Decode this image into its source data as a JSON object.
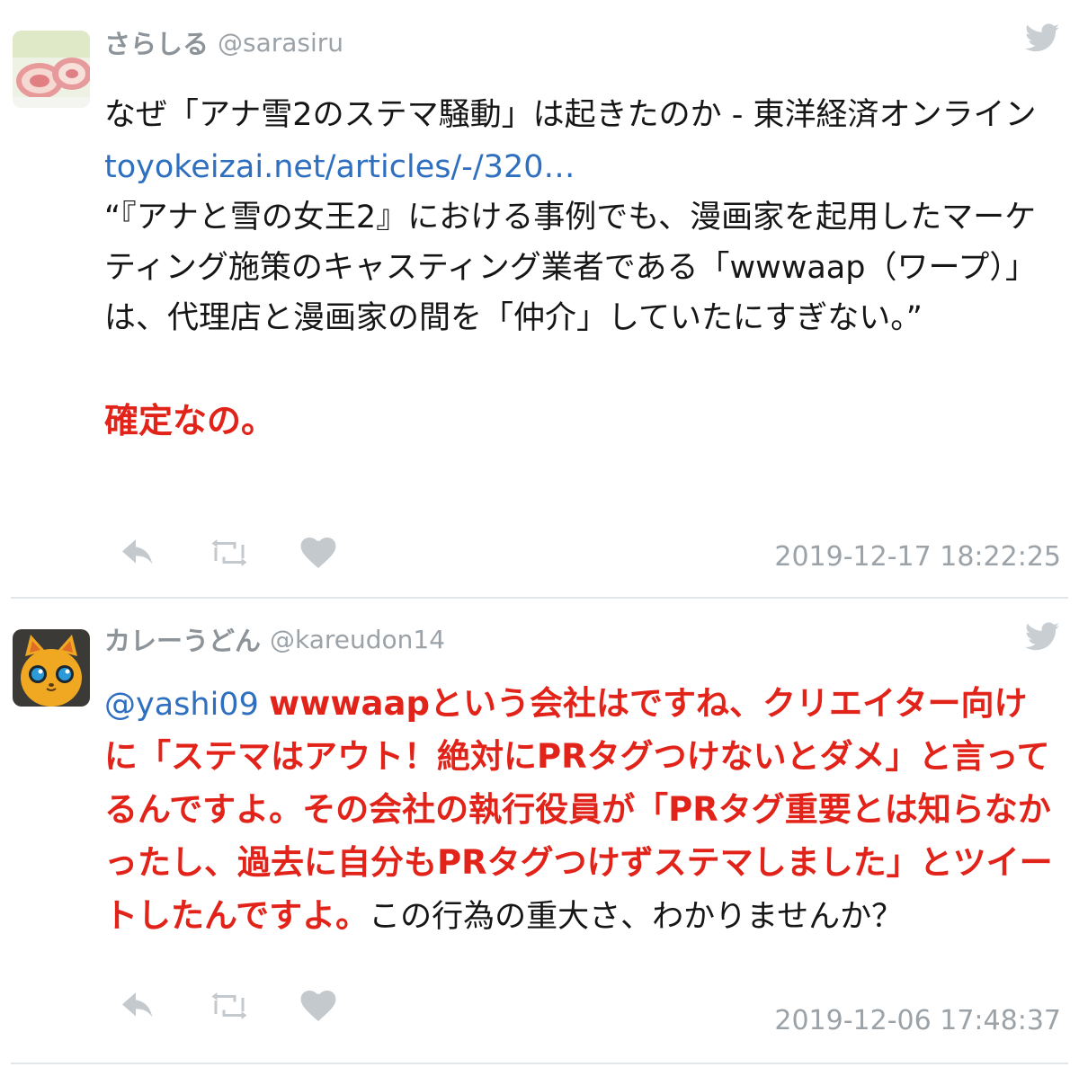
{
  "tweets": [
    {
      "user": {
        "name": "さらしる",
        "handle": "@sarasiru"
      },
      "title_line": "なぜ「アナ雪2のステマ騒動」は起きたのか - 東洋経済オンライン",
      "link_text": "toyokeizai.net/articles/-/320…",
      "quote": "“『アナと雪の女王2』における事例でも、漫画家を起用したマーケティング施策のキャスティング業者である「wwwaap（ワープ）」は、代理店と漫画家の間を「仲介」していたにすぎない。”",
      "emphasis": "確定なの。",
      "timestamp": "2019-12-17 18:22:25"
    },
    {
      "user": {
        "name": "カレーうどん",
        "handle": "@kareudon14"
      },
      "mention": "@yashi09",
      "emphasis": "wwwaapという会社はですね、クリエイター向けに「ステマはアウト！絶対にPRタグつけないとダメ」と言ってるんですよ。その会社の執行役員が「PRタグ重要とは知らなかったし、過去に自分もPRタグつけずステマしました」とツイートしたんですよ。",
      "plain": "この行為の重大さ、わかりませんか？",
      "timestamp": "2019-12-06 17:48:37"
    }
  ],
  "icons": {
    "reply": "reply-icon",
    "retweet": "retweet-icon",
    "like": "heart-icon",
    "brand": "twitter-bird-icon"
  },
  "colors": {
    "emphasis_red": "#e2231a",
    "link_blue": "#2f6fbf",
    "meta_gray": "#9ba2a8"
  }
}
